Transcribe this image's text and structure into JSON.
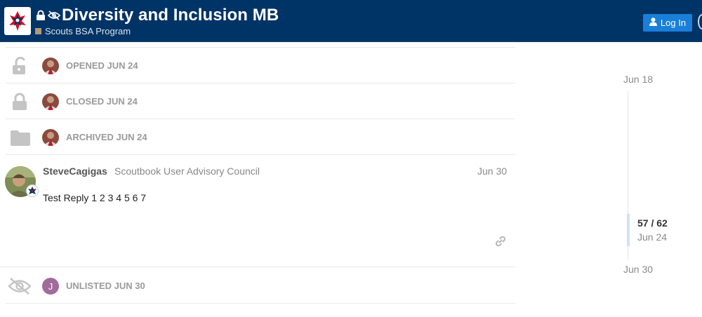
{
  "header": {
    "title": "Diversity and Inclusion MB",
    "category": "Scouts BSA Program",
    "login_label": "Log In"
  },
  "actions": [
    {
      "icon": "lock-open-icon",
      "text": "Opened Jun 24"
    },
    {
      "icon": "lock-icon",
      "text": "Closed Jun 24"
    },
    {
      "icon": "folder-icon",
      "text": "Archived Jun 24"
    }
  ],
  "post": {
    "username": "SteveCagigas",
    "user_title": "Scoutbook User Advisory Council",
    "date": "Jun 30",
    "body": "Test Reply 1 2 3 4 5 6 7"
  },
  "unlisted": {
    "icon": "eye-slash-icon",
    "avatar_letter": "J",
    "text": "Unlisted Jun 30"
  },
  "timeline": {
    "start": "Jun 18",
    "position": "57 / 62",
    "current_date": "Jun 24",
    "end": "Jun 30"
  },
  "colors": {
    "header_bg": "#003366",
    "login_bg": "#1a7fd8",
    "category_swatch": "#b09a72",
    "avatar_j": "#a16b9c"
  }
}
